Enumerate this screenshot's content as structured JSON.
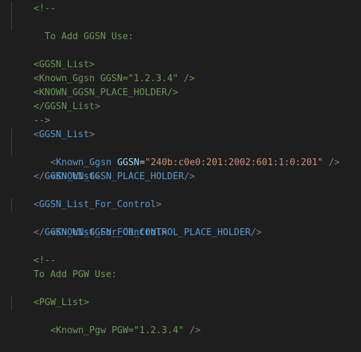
{
  "editor": {
    "comment1_open": "<!--",
    "comment1_text": "To Add GGSN Use:",
    "comment1_example_open": "<GGSN_List>",
    "comment1_example_known": "<Known_Ggsn GGSN=\"1.2.3.4\" />",
    "comment1_example_placeholder": "<KNOWN_GGSN_PLACE_HOLDER/>",
    "comment1_example_close": "</GGSN_List>",
    "comment1_close": "-->",
    "ggsn_list_tag": "GGSN_List",
    "known_ggsn_tag": "Known_Ggsn",
    "ggsn_attr": "GGSN",
    "ggsn_value": "\"240b:c0e0:201:2002:601:1:0:201\"",
    "known_ggsn_placeholder_tag": "KNOWN_GGSN_PLACE_HOLDER",
    "ggsn_list_for_control_tag": "GGSN_List_For_Control",
    "known_ggsn_for_control_placeholder_tag": "KNOWN_GGSN_FOR_CONTROL_PLACE_HOLDER",
    "comment2_open": "<!--",
    "comment2_text": "To Add PGW Use:",
    "pgw_example_open": "<PGW_List>",
    "pgw_example_known": "<Known_Pgw PGW=\"1.2.3.4\" />"
  },
  "colors": {
    "background": "#1e1e1e",
    "comment": "#6a9955",
    "tag": "#569cd6",
    "attribute": "#9cdcfe",
    "string": "#ce9178",
    "bracket": "#808080"
  }
}
